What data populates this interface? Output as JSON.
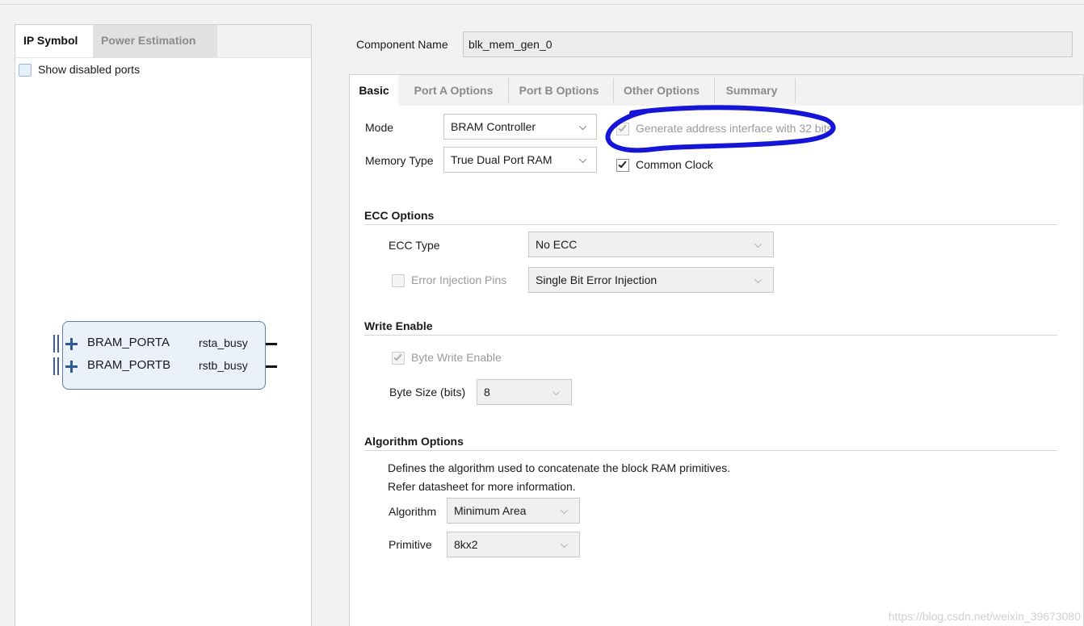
{
  "left_panel": {
    "tabs": [
      {
        "label": "IP Symbol",
        "active": true
      },
      {
        "label": "Power Estimation",
        "active": false
      }
    ],
    "show_disabled_ports": {
      "label": "Show disabled ports",
      "checked": false
    },
    "symbol": {
      "ports_left": [
        "BRAM_PORTA",
        "BRAM_PORTB"
      ],
      "ports_right": [
        "rsta_busy",
        "rstb_busy"
      ]
    }
  },
  "component": {
    "label": "Component Name",
    "value": "blk_mem_gen_0"
  },
  "tabs": [
    {
      "label": "Basic",
      "active": true
    },
    {
      "label": "Port A Options",
      "active": false
    },
    {
      "label": "Port B Options",
      "active": false
    },
    {
      "label": "Other Options",
      "active": false
    },
    {
      "label": "Summary",
      "active": false
    }
  ],
  "basic": {
    "mode": {
      "label": "Mode",
      "value": "BRAM Controller"
    },
    "memory_type": {
      "label": "Memory Type",
      "value": "True Dual Port RAM"
    },
    "generate_address": {
      "label": "Generate address interface with 32 bits",
      "checked": true,
      "disabled": true
    },
    "common_clock": {
      "label": "Common Clock",
      "checked": true
    }
  },
  "ecc": {
    "title": "ECC Options",
    "ecc_type": {
      "label": "ECC Type",
      "value": "No ECC"
    },
    "error_injection": {
      "label": "Error Injection Pins",
      "value": "Single Bit Error Injection",
      "checked": false,
      "disabled": true
    }
  },
  "write_enable": {
    "title": "Write Enable",
    "byte_write_enable": {
      "label": "Byte Write Enable",
      "checked": true,
      "disabled": true
    },
    "byte_size": {
      "label": "Byte Size (bits)",
      "value": "8"
    }
  },
  "algorithm": {
    "title": "Algorithm Options",
    "desc_line1": "Defines the algorithm used to concatenate the block RAM primitives.",
    "desc_line2": "Refer datasheet for more information.",
    "algorithm": {
      "label": "Algorithm",
      "value": "Minimum Area"
    },
    "primitive": {
      "label": "Primitive",
      "value": "8kx2"
    }
  },
  "watermark": "https://blog.csdn.net/weixin_39673080",
  "colors": {
    "annotation": "#1515d8",
    "symbol_border": "#5f7ea8",
    "symbol_fill": "#eaf1fa"
  }
}
